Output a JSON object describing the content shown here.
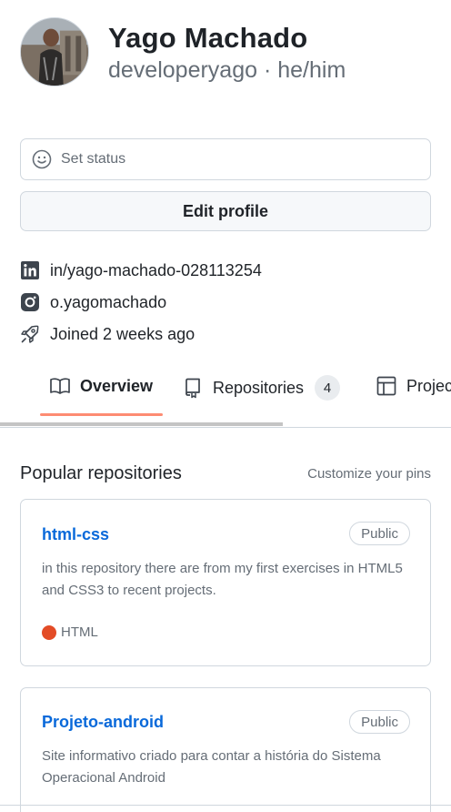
{
  "profile": {
    "name": "Yago Machado",
    "handle": "developeryago · he/him"
  },
  "status": {
    "placeholder": "Set status"
  },
  "edit_profile_label": "Edit profile",
  "meta": {
    "linkedin": "in/yago-machado-028113254",
    "instagram": "o.yagomachado",
    "joined": "Joined 2 weeks ago"
  },
  "tabs": [
    {
      "label": "Overview",
      "icon": "book-icon",
      "active": true
    },
    {
      "label": "Repositories",
      "icon": "repo-icon",
      "count": "4"
    },
    {
      "label": "Projects",
      "icon": "table-icon"
    }
  ],
  "popular": {
    "title": "Popular repositories",
    "customize": "Customize your pins"
  },
  "repos": [
    {
      "name": "html-css",
      "visibility": "Public",
      "description": "in this repository there are from my first exercises in HTML5 and CSS3 to recent projects.",
      "language": "HTML",
      "language_color": "#e34c26"
    },
    {
      "name": "Projeto-android",
      "visibility": "Public",
      "description": "Site informativo criado para contar a história do Sistema Operacional Android"
    }
  ],
  "colors": {
    "accent": "#0969da",
    "tab_underline": "#fd8c73",
    "muted": "#656d76",
    "border": "#d0d7de"
  }
}
